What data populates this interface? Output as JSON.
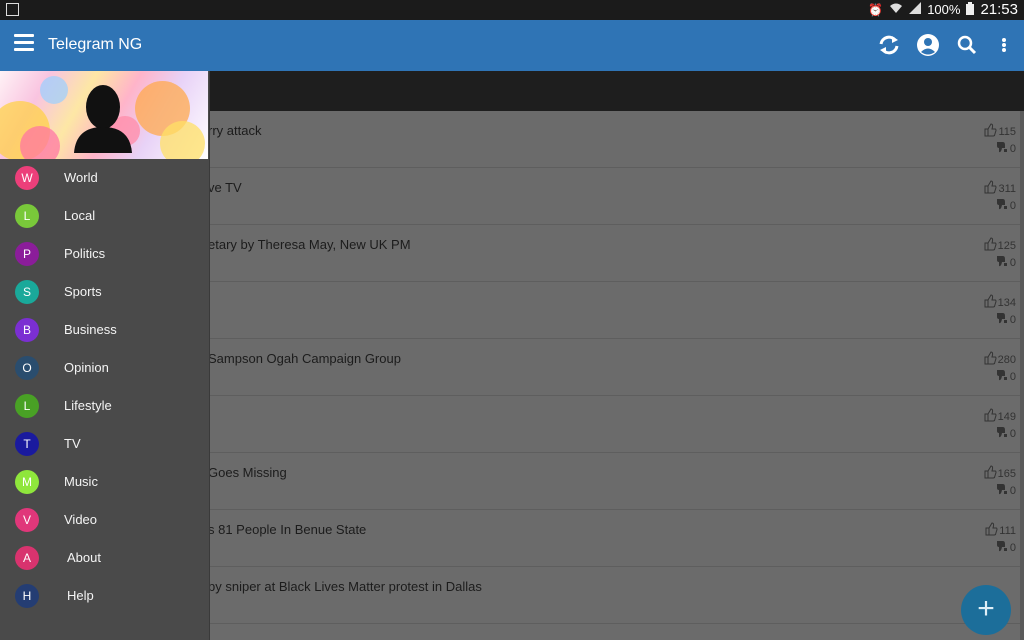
{
  "status_bar": {
    "battery": "100%",
    "time": "21:53"
  },
  "app_bar": {
    "title": "Telegram NG"
  },
  "drawer": {
    "items": [
      {
        "letter": "W",
        "label": "World",
        "color": "#ec3f7a"
      },
      {
        "letter": "L",
        "label": "Local",
        "color": "#79c83a"
      },
      {
        "letter": "P",
        "label": "Politics",
        "color": "#8b1d9a"
      },
      {
        "letter": "S",
        "label": "Sports",
        "color": "#1aa99a"
      },
      {
        "letter": "B",
        "label": "Business",
        "color": "#7b2fd2"
      },
      {
        "letter": "O",
        "label": "Opinion",
        "color": "#2a4d6e"
      },
      {
        "letter": "L",
        "label": "Lifestyle",
        "color": "#49a125"
      },
      {
        "letter": "T",
        "label": "TV",
        "color": "#1a1a9e"
      },
      {
        "letter": "M",
        "label": "Music",
        "color": "#8fe63c"
      },
      {
        "letter": "V",
        "label": "Video",
        "color": "#e0377a"
      },
      {
        "letter": "A",
        "label": "About",
        "color": "#d8336e"
      },
      {
        "letter": "H",
        "label": "Help",
        "color": "#243d73"
      }
    ]
  },
  "articles": [
    {
      "title": "rry attack",
      "likes": "115",
      "dislikes": "0"
    },
    {
      "title": "ve TV",
      "likes": "311",
      "dislikes": "0"
    },
    {
      "title": "etary by Theresa May, New UK PM",
      "likes": "125",
      "dislikes": "0"
    },
    {
      "title": "",
      "likes": "134",
      "dislikes": "0"
    },
    {
      "title": "Sampson Ogah Campaign Group",
      "likes": "280",
      "dislikes": "0"
    },
    {
      "title": "",
      "likes": "149",
      "dislikes": "0"
    },
    {
      "title": "Goes Missing",
      "likes": "165",
      "dislikes": "0"
    },
    {
      "title": "s 81 People In Benue State",
      "likes": "111",
      "dislikes": "0"
    },
    {
      "title": "by sniper at Black Lives Matter protest in Dallas",
      "likes": "",
      "dislikes": ""
    }
  ],
  "fab": {
    "label": "+"
  }
}
